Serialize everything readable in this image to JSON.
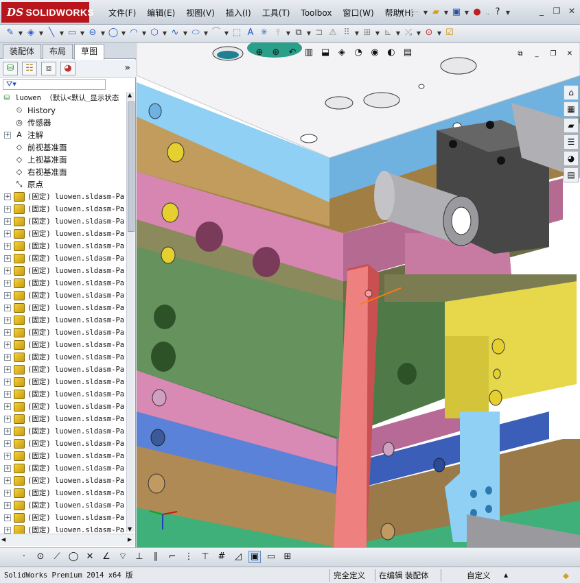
{
  "app": {
    "logo_text": "SOLIDWORKS",
    "logo_prefix": "DS",
    "menu": [
      "文件(F)",
      "编辑(E)",
      "视图(V)",
      "插入(I)",
      "工具(T)",
      "Toolbox",
      "窗口(W)",
      "帮助(H)"
    ],
    "window_controls": [
      "_",
      "❐",
      "✕"
    ],
    "help_icon": "?"
  },
  "panel": {
    "tabs": [
      "装配体",
      "布局",
      "草图"
    ],
    "active_tab": "草图",
    "filter_icon": "filter-icon",
    "collapse_label": "»"
  },
  "tree": {
    "root": "luowen （默认<默认_显示状态",
    "items": [
      {
        "label": "History",
        "icon": "history-icon",
        "expand": false
      },
      {
        "label": "传感器",
        "icon": "sensor-icon",
        "expand": false
      },
      {
        "label": "注解",
        "icon": "annotation-icon",
        "expand": true
      },
      {
        "label": "前视基准面",
        "icon": "plane-icon",
        "expand": false
      },
      {
        "label": "上视基准面",
        "icon": "plane-icon",
        "expand": false
      },
      {
        "label": "右视基准面",
        "icon": "plane-icon",
        "expand": false
      },
      {
        "label": "原点",
        "icon": "origin-icon",
        "expand": false
      }
    ],
    "part_label": "(固定) luowen.sldasm-Pa",
    "part_count": 28
  },
  "status": {
    "version": "SolidWorks Premium 2014 x64 版",
    "state1": "完全定义",
    "state2": "在编辑 装配体",
    "units": "自定义",
    "units_arrow": "▲"
  },
  "colors": {
    "top_plate": "#f2f2f4",
    "blue_plate": "#86c6ea",
    "tan_plate": "#b8924f",
    "pink_plate": "#c77aa2",
    "olive_plate": "#7c7c52",
    "green_plate": "#5f8a58",
    "blue2_plate": "#4f74c8",
    "rod": "#e0706a",
    "yellow_block": "#e6d84a",
    "dark_block": "#4a4a4a",
    "cyan_part": "#8fd0f4",
    "accent": "#b8161c"
  }
}
